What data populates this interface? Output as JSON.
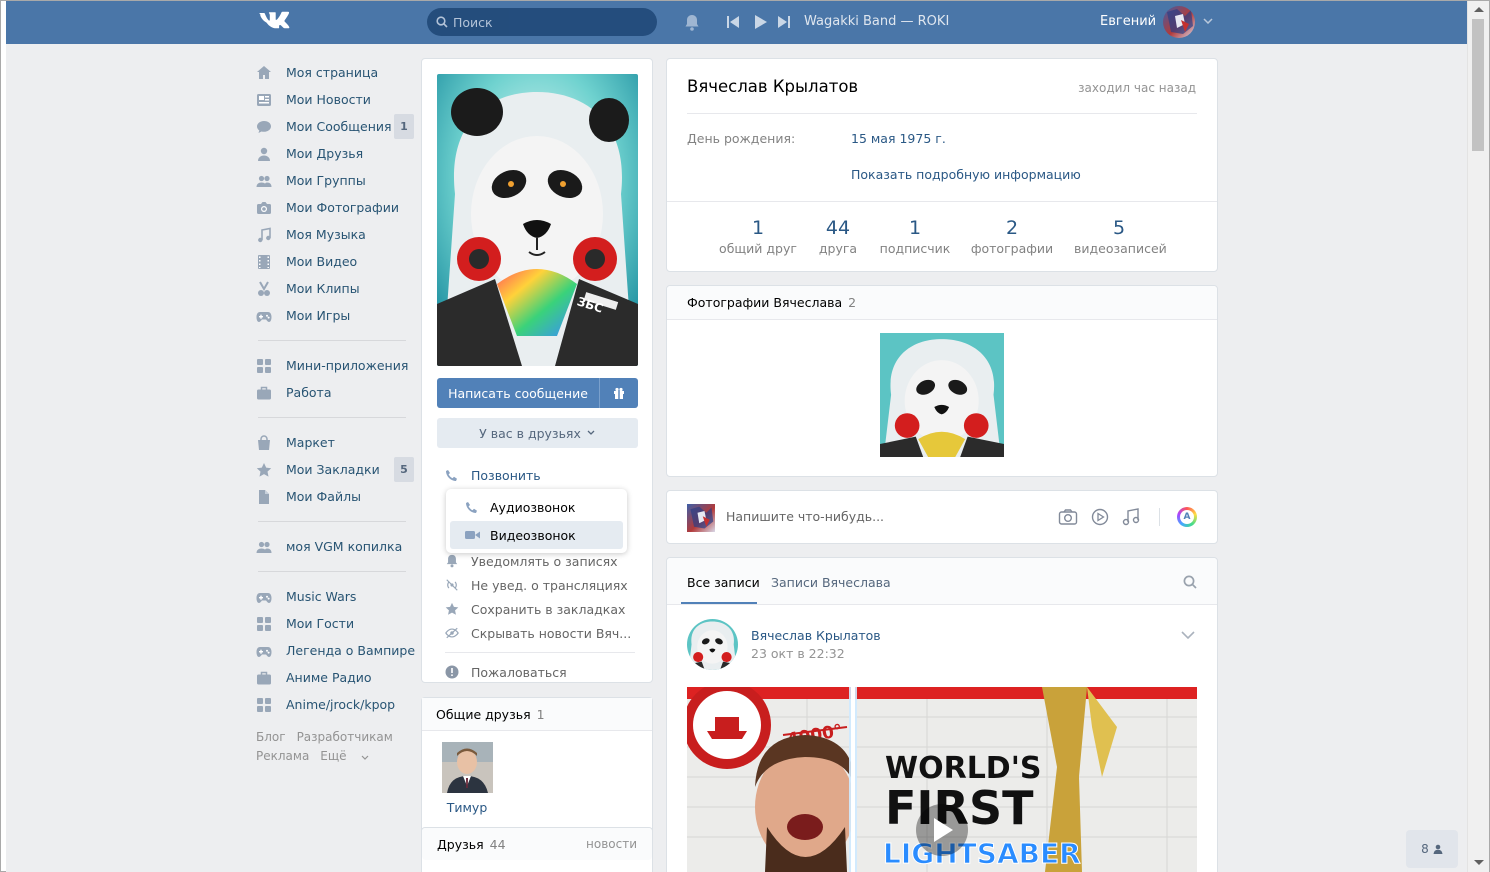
{
  "header": {
    "search_placeholder": "Поиск",
    "now_playing": "Wagakki Band — ROKI",
    "user_name": "Евгений"
  },
  "sidebar": {
    "items": [
      {
        "label": "Моя страница",
        "icon": "home-icon"
      },
      {
        "label": "Мои Новости",
        "icon": "news-icon"
      },
      {
        "label": "Мои Сообщения",
        "icon": "messages-icon",
        "badge": "1"
      },
      {
        "label": "Мои Друзья",
        "icon": "friend-icon"
      },
      {
        "label": "Мои Группы",
        "icon": "groups-icon"
      },
      {
        "label": "Мои Фотографии",
        "icon": "camera-icon"
      },
      {
        "label": "Моя Музыка",
        "icon": "music-icon"
      },
      {
        "label": "Мои Видео",
        "icon": "film-icon"
      },
      {
        "label": "Мои Клипы",
        "icon": "clips-icon"
      },
      {
        "label": "Мои Игры",
        "icon": "gamepad-icon"
      }
    ],
    "items2": [
      {
        "label": "Мини-приложения",
        "icon": "apps-icon"
      },
      {
        "label": "Работа",
        "icon": "briefcase-icon"
      }
    ],
    "items3": [
      {
        "label": "Маркет",
        "icon": "bag-icon"
      },
      {
        "label": "Мои Закладки",
        "icon": "star-icon",
        "badge": "5"
      },
      {
        "label": "Мои Файлы",
        "icon": "file-icon"
      }
    ],
    "items4": [
      {
        "label": "моя VGM копилка",
        "icon": "groups-icon"
      }
    ],
    "items5": [
      {
        "label": "Music Wars",
        "icon": "gamepad-icon"
      },
      {
        "label": "Мои Гости",
        "icon": "apps-icon"
      },
      {
        "label": "Легенда о Вампире",
        "icon": "gamepad-icon"
      },
      {
        "label": "Аниме Радио",
        "icon": "briefcase-icon"
      },
      {
        "label": "Anime/jrock/kpop",
        "icon": "apps-icon"
      }
    ],
    "footer": {
      "blog": "Блог",
      "devs": "Разработчикам",
      "ads": "Реклама",
      "more": "Ещё"
    }
  },
  "profile": {
    "send_message": "Написать сообщение",
    "friend_status": "У вас в друзьях",
    "call": "Позвонить",
    "actions": [
      {
        "label": "Уведомлять о записях",
        "icon": "bell-icon"
      },
      {
        "label": "Не увед. о трансляциях",
        "icon": "broadcast-icon"
      },
      {
        "label": "Сохранить в закладках",
        "icon": "star-icon"
      },
      {
        "label": "Скрывать новости Вяч...",
        "icon": "eye-off-icon"
      }
    ],
    "report": "Пожаловаться",
    "call_menu": {
      "audio": "Аудиозвонок",
      "video": "Видеозвонок"
    },
    "name": "Вячеслав Крылатов",
    "last_seen": "заходил час назад",
    "birthday_label": "День рождения:",
    "birthday_value": "15 мая 1975 г.",
    "show_more": "Показать подробную информацию",
    "counters": [
      {
        "num": "1",
        "label": "общий друг"
      },
      {
        "num": "44",
        "label": "друга"
      },
      {
        "num": "1",
        "label": "подписчик"
      },
      {
        "num": "2",
        "label": "фотографии"
      },
      {
        "num": "5",
        "label": "видеозаписей"
      }
    ]
  },
  "mutual": {
    "title": "Общие друзья",
    "count": "1",
    "friend_name": "Тимур"
  },
  "friends": {
    "title": "Друзья",
    "count": "44",
    "link": "новости"
  },
  "photos": {
    "title": "Фотографии Вячеслава",
    "count": "2"
  },
  "composer": {
    "placeholder": "Напишите что-нибудь..."
  },
  "wall": {
    "tab_all": "Все записи",
    "tab_own": "Записи Вячеслава",
    "post_author": "Вячеслав Крылатов",
    "post_date": "23 окт в 22:32",
    "media_line1": "WORLD'S",
    "media_line2": "FIRST",
    "media_line3": "LIGHTSABER",
    "media_badge": "4000°"
  },
  "chat": {
    "online_count": "8"
  },
  "colors": {
    "header": "#4a76a8",
    "link": "#2a5885",
    "button": "#5181b8",
    "background": "#edeef0"
  }
}
